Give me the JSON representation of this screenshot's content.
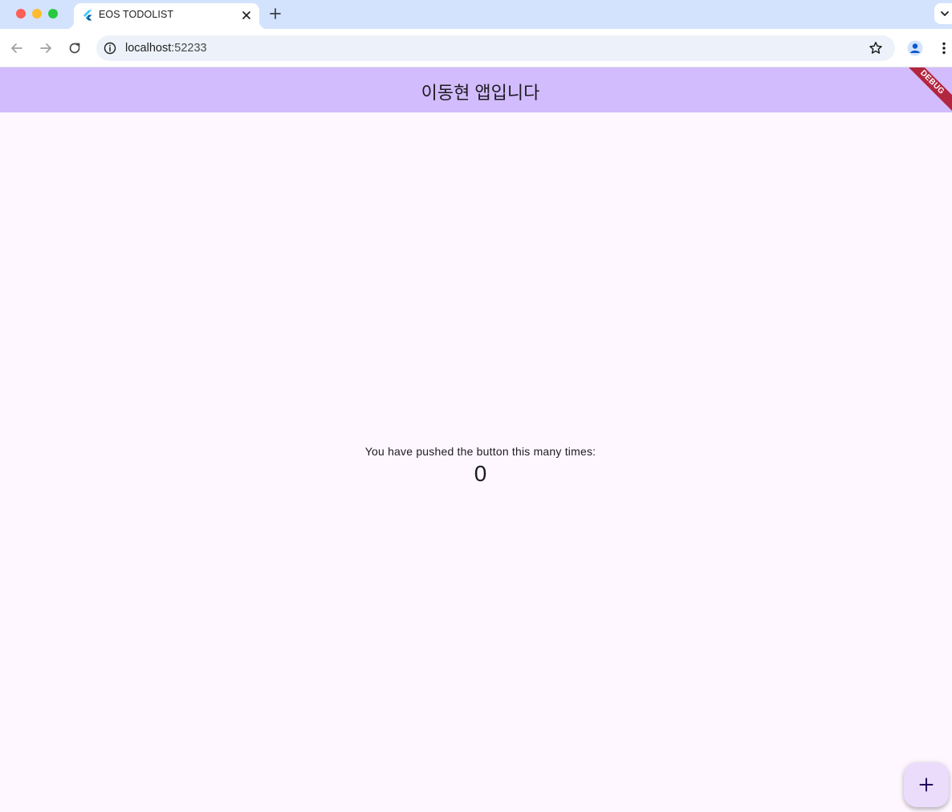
{
  "browser": {
    "tab": {
      "title": "EOS TODOLIST"
    },
    "address": {
      "host": "localhost",
      "port": ":52233"
    }
  },
  "app": {
    "appbar_title": "이동현 앱입니다",
    "debug_banner": "DEBUG",
    "counter_label": "You have pushed the button this many times:",
    "counter_value": "0",
    "fab_icon": "add-icon"
  },
  "colors": {
    "appbar": "#d2bcfd",
    "background": "#fef7ff",
    "fab": "#ebdcfb",
    "debug": "#b3263f"
  }
}
